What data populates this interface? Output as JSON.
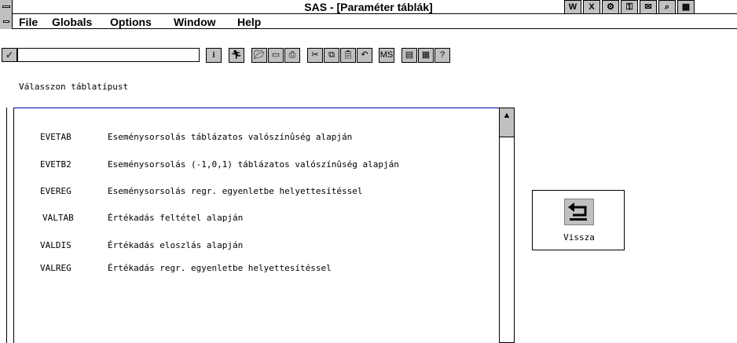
{
  "window": {
    "title": "SAS - [Paraméter táblák]"
  },
  "menu": {
    "items": [
      "File",
      "Globals",
      "Options",
      "Window",
      "Help"
    ]
  },
  "toolbar": {
    "command_value": "",
    "buttons": [
      "dropdown",
      "run",
      "open",
      "save",
      "print",
      "cut",
      "copy",
      "paste",
      "undo",
      "ms-dos",
      "output",
      "table",
      "help"
    ]
  },
  "main": {
    "prompt": "Válasszon táblatípust",
    "rows": [
      {
        "code": "EVETAB",
        "description": "Eseménysorsolás táblázatos valószínûség alapján"
      },
      {
        "code": "EVETB2",
        "description": "Eseménysorsolás (-1,0,1) táblázatos valószínûség alapján"
      },
      {
        "code": "EVEREG",
        "description": "Eseménysorsolás regr. egyenletbe helyettesítéssel"
      },
      {
        "code": "VALTAB",
        "description": "Értékadás feltétel alapján"
      },
      {
        "code": "VALDIS",
        "description": "Értékadás eloszlás alapján"
      },
      {
        "code": "VALREG",
        "description": "Értékadás regr. egyenletbe helyettesítéssel"
      }
    ],
    "back_button_label": "Vissza"
  },
  "colors": {
    "highlight_text": "#c8a000",
    "listbox_border": "#0000a0",
    "button_face": "#c0c0c0"
  }
}
